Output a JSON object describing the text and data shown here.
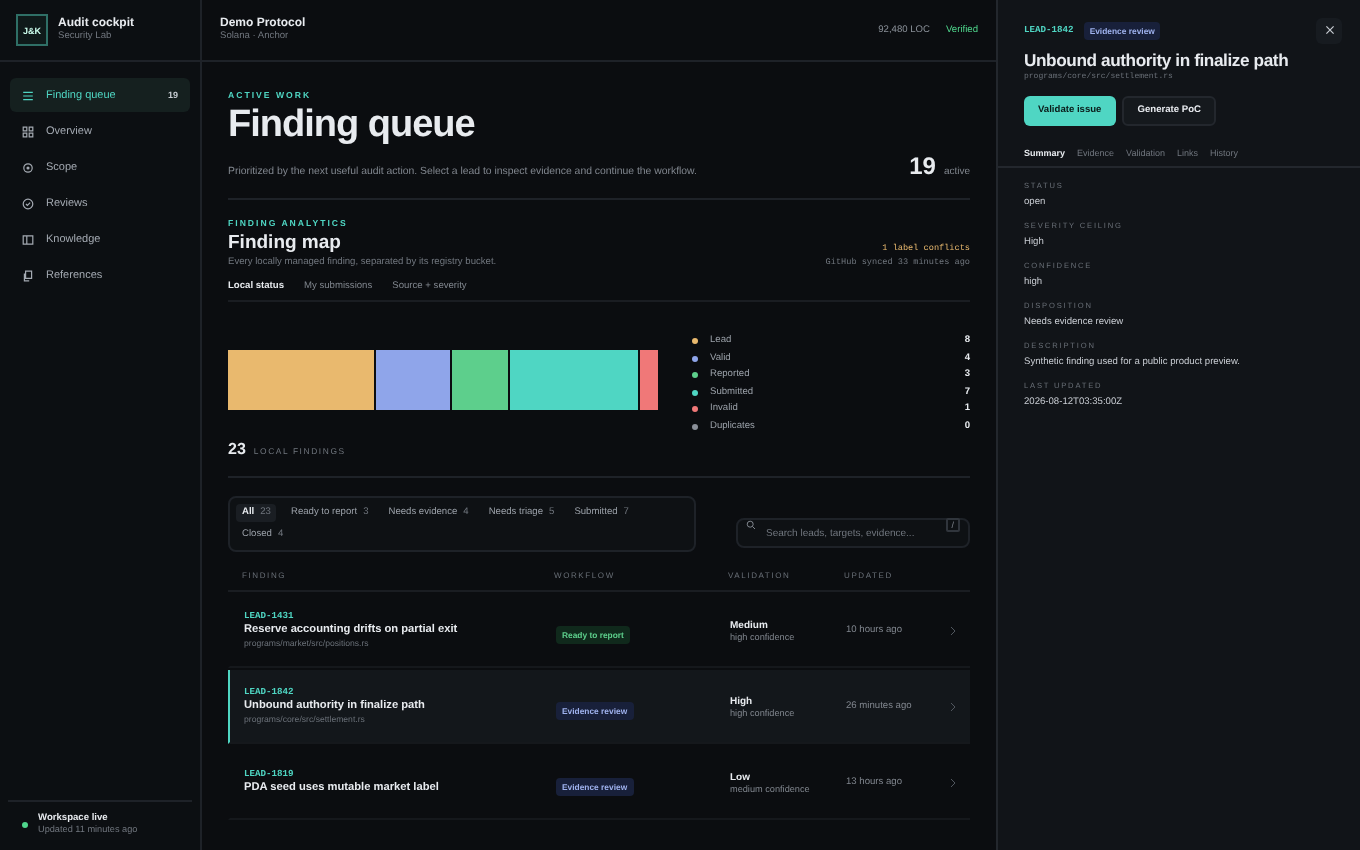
{
  "sidebar": {
    "logo": "J&K",
    "title": "Audit cockpit",
    "subtitle": "Security Lab",
    "items": [
      {
        "label": "Finding queue",
        "count": "19",
        "selected": true
      },
      {
        "label": "Overview",
        "selected": false
      },
      {
        "label": "Scope",
        "selected": false
      },
      {
        "label": "Reviews",
        "selected": false
      },
      {
        "label": "Knowledge",
        "selected": false
      },
      {
        "label": "References",
        "selected": false
      }
    ],
    "status": {
      "title": "Workspace live",
      "subtitle": "Updated 11 minutes ago"
    }
  },
  "topbar": {
    "project": "Demo Protocol",
    "platform": "Solana · Anchor",
    "loc": "92,480 LOC",
    "verification": "Verified"
  },
  "header": {
    "eyebrow": "ACTIVE WORK",
    "title": "Finding queue",
    "description": "Prioritized by the next useful audit action. Select a lead to inspect evidence and continue the workflow.",
    "count": "19",
    "count_label": "active"
  },
  "analytics": {
    "eyebrow": "FINDING ANALYTICS",
    "title": "Finding map",
    "description": "Every locally managed finding, separated by its registry bucket.",
    "conflicts": "1 label conflicts",
    "sync": "GitHub synced 33 minutes ago",
    "tabs": [
      {
        "label": "Local status",
        "selected": true
      },
      {
        "label": "My submissions",
        "selected": false
      },
      {
        "label": "Source + severity",
        "selected": false
      }
    ],
    "legend": [
      {
        "label": "Lead",
        "count": "8",
        "color": "#e9b96e"
      },
      {
        "label": "Valid",
        "count": "4",
        "color": "#8fa5ea"
      },
      {
        "label": "Reported",
        "count": "3",
        "color": "#5dcf8c"
      },
      {
        "label": "Submitted",
        "count": "7",
        "color": "#4fd6c3"
      },
      {
        "label": "Invalid",
        "count": "1",
        "color": "#f07878"
      },
      {
        "label": "Duplicates",
        "count": "0",
        "color": "#8a8f98"
      }
    ],
    "total": "23",
    "total_label": "LOCAL FINDINGS"
  },
  "filters": {
    "chips": [
      {
        "label": "All",
        "count": "23",
        "selected": true
      },
      {
        "label": "Ready to report",
        "count": "3",
        "selected": false
      },
      {
        "label": "Needs evidence",
        "count": "4",
        "selected": false
      },
      {
        "label": "Needs triage",
        "count": "5",
        "selected": false
      },
      {
        "label": "Submitted",
        "count": "7",
        "selected": false
      },
      {
        "label": "Closed",
        "count": "4",
        "selected": false
      }
    ],
    "search": {
      "placeholder": "Search leads, targets, evidence...",
      "shortcut": "/"
    }
  },
  "table": {
    "columns": [
      "FINDING",
      "WORKFLOW",
      "VALIDATION",
      "UPDATED"
    ],
    "rows": [
      {
        "id": "LEAD-1431",
        "title": "Reserve accounting drifts on partial exit",
        "path": "programs/market/src/positions.rs",
        "workflow": "Ready to report",
        "kind": "ready",
        "severity": "Medium",
        "confidence": "high confidence",
        "updated": "10 hours ago",
        "selected": false
      },
      {
        "id": "LEAD-1842",
        "title": "Unbound authority in finalize path",
        "path": "programs/core/src/settlement.rs",
        "workflow": "Evidence review",
        "kind": "review",
        "severity": "High",
        "confidence": "high confidence",
        "updated": "26 minutes ago",
        "selected": true
      },
      {
        "id": "LEAD-1819",
        "title": "PDA seed uses mutable market label",
        "workflow": "Evidence review",
        "kind": "review",
        "severity": "Low",
        "confidence": "medium confidence",
        "updated": "13 hours ago",
        "selected": false
      }
    ]
  },
  "detail": {
    "id": "LEAD-1842",
    "badge": "Evidence review",
    "title": "Unbound authority in finalize path",
    "path": "programs/core/src/settlement.rs",
    "primary_action": "Validate issue",
    "secondary_action": "Generate PoC",
    "tabs": [
      {
        "label": "Summary",
        "selected": true
      },
      {
        "label": "Evidence",
        "selected": false
      },
      {
        "label": "Validation",
        "selected": false
      },
      {
        "label": "Links",
        "selected": false
      },
      {
        "label": "History",
        "selected": false
      }
    ],
    "fields": [
      {
        "label": "STATUS",
        "value": "open"
      },
      {
        "label": "SEVERITY CEILING",
        "value": "High"
      },
      {
        "label": "CONFIDENCE",
        "value": "high"
      },
      {
        "label": "DISPOSITION",
        "value": "Needs evidence review"
      },
      {
        "label": "DESCRIPTION",
        "value": "Synthetic finding used for a public product preview."
      },
      {
        "label": "LAST UPDATED",
        "value": "2026-08-12T03:35:00Z"
      }
    ]
  }
}
